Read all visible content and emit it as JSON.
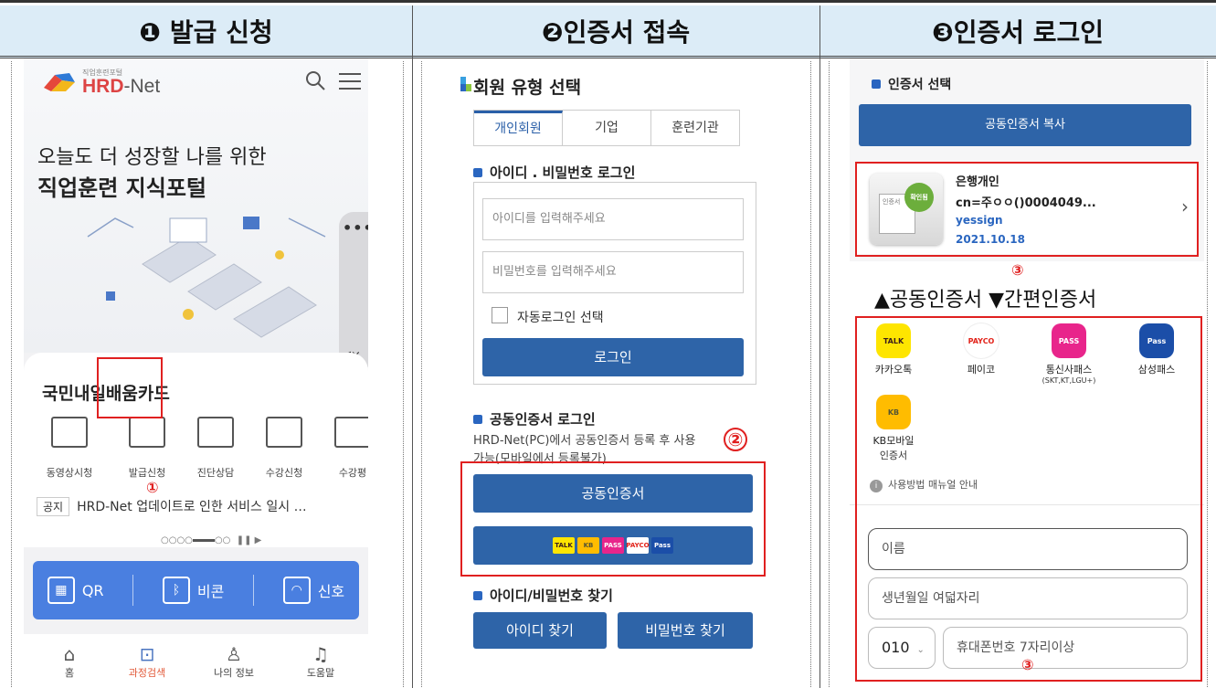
{
  "headers": {
    "step1": "❶ 발급 신청",
    "step2": "❷인증서 접속",
    "step3": "❸인증서 로그인"
  },
  "panel1": {
    "logo_small": "직업훈련포털",
    "logo_hrd": "HRD",
    "logo_net": "-Net",
    "hero_line1": "오늘도 더 성장할 나를 위한",
    "hero_line2": "직업훈련 지식포털",
    "side_dots": "•••",
    "mute_icon": "mute-icon",
    "card_title": "국민내일배움카드",
    "menu": [
      {
        "label": "동영상시청"
      },
      {
        "label": "발급신청"
      },
      {
        "label": "진단상담"
      },
      {
        "label": "수강신청"
      },
      {
        "label": "수강평"
      }
    ],
    "marker1": "①",
    "notice_tag": "공지",
    "notice_text": "HRD-Net 업데이트로 인한 서비스 일시 …",
    "bluebar": [
      {
        "label": "QR",
        "icon": "qr-icon"
      },
      {
        "label": "비콘",
        "icon": "bluetooth-icon"
      },
      {
        "label": "신호",
        "icon": "wifi-icon"
      }
    ],
    "nav": [
      {
        "label": "홈",
        "icon": "home-icon"
      },
      {
        "label": "과정검색",
        "icon": "search-doc-icon"
      },
      {
        "label": "나의 정보",
        "icon": "person-icon"
      },
      {
        "label": "도움말",
        "icon": "bell-icon"
      }
    ]
  },
  "panel2": {
    "title": "회원 유형 선택",
    "tabs": [
      "개인회원",
      "기업",
      "훈련기관"
    ],
    "section_login": "아이디 . 비밀번호 로그인",
    "id_placeholder": "아이디를 입력해주세요",
    "pw_placeholder": "비밀번호를 입력해주세요",
    "auto_login": "자동로그인 선택",
    "login_btn": "로그인",
    "section_cert": "공동인증서 로그인",
    "cert_desc_1": "HRD-Net(PC)에서 공동인증서 등록 후 사용",
    "cert_desc_2": "가능(모바일에서 등록불가)",
    "marker2": "②",
    "cert_btn": "공동인증서",
    "section_find": "아이디/비밀번호 찾기",
    "find_id_btn": "아이디 찾기",
    "find_pw_btn": "비밀번호 찾기",
    "mini_icons": [
      "TALK",
      "KB",
      "PASS",
      "PAYCO",
      "Pass"
    ]
  },
  "panel3": {
    "section_cert": "인증서 선택",
    "copy_btn": "공동인증서 복사",
    "cert_name": "은행개인",
    "cert_cn": "cn=주ㅇㅇ()0004049...",
    "cert_issuer": "yessign",
    "cert_date": "2021.10.18",
    "cert_badge": "확인됨",
    "cert_label": "인증서",
    "marker3a": "③",
    "caption": "▲공동인증서 ▼간편인증서",
    "apps": [
      {
        "label": "카카오톡",
        "sub": "",
        "badge": "TALK"
      },
      {
        "label": "페이코",
        "sub": "",
        "badge": "PAYCO"
      },
      {
        "label": "통신사패스",
        "sub": "(SKT,KT,LGU+)",
        "badge": "PASS"
      },
      {
        "label": "삼성패스",
        "sub": "",
        "badge": "Pass"
      },
      {
        "label": "KB모바일",
        "sub": "인증서",
        "badge": "KB"
      }
    ],
    "manual": "사용방법 매뉴얼 안내",
    "name_placeholder": "이름",
    "birth_placeholder": "생년월일 여덟자리",
    "phone_prefix": "010",
    "phone_placeholder": "휴대폰번호 7자리이상",
    "marker3b": "③"
  }
}
